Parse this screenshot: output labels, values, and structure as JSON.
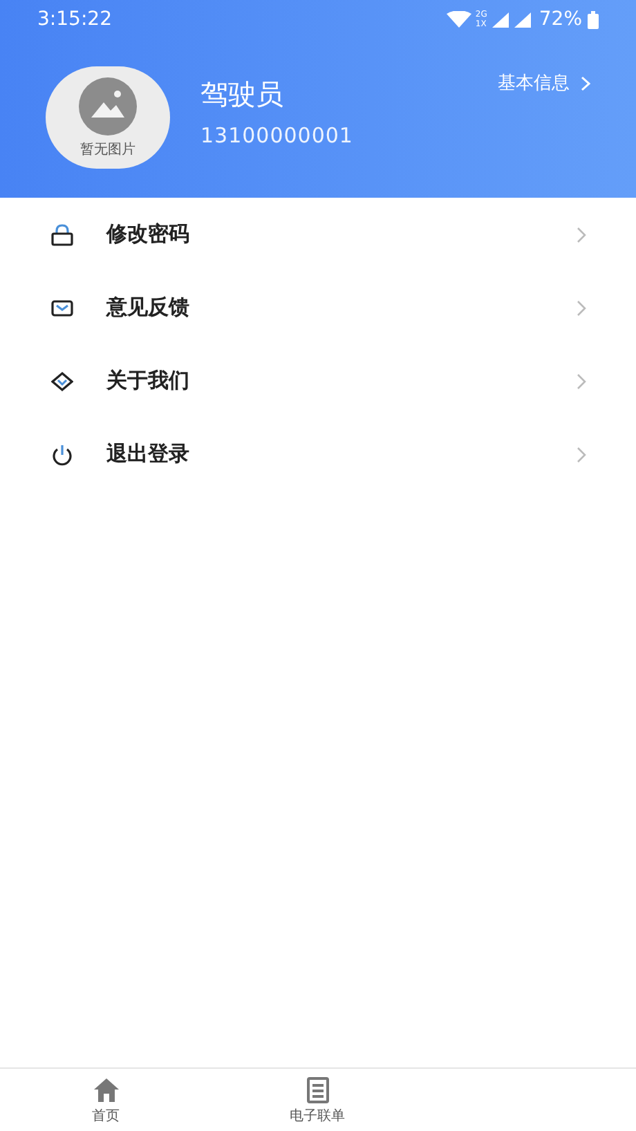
{
  "status_bar": {
    "time": "3:15:22",
    "network": "2G 1X",
    "battery": "72%"
  },
  "profile": {
    "avatar_text": "暂无图片",
    "name": "驾驶员",
    "phone": "13100000001",
    "info_link": "基本信息"
  },
  "menu": [
    {
      "kind": "lock",
      "label": "修改密码"
    },
    {
      "kind": "mail",
      "label": "意见反馈"
    },
    {
      "kind": "diamond",
      "label": "关于我们"
    },
    {
      "kind": "power",
      "label": "退出登录"
    }
  ],
  "bottom_nav": [
    {
      "kind": "home",
      "label": "首页",
      "selected": false
    },
    {
      "kind": "list",
      "label": "电子联单",
      "selected": false
    }
  ]
}
